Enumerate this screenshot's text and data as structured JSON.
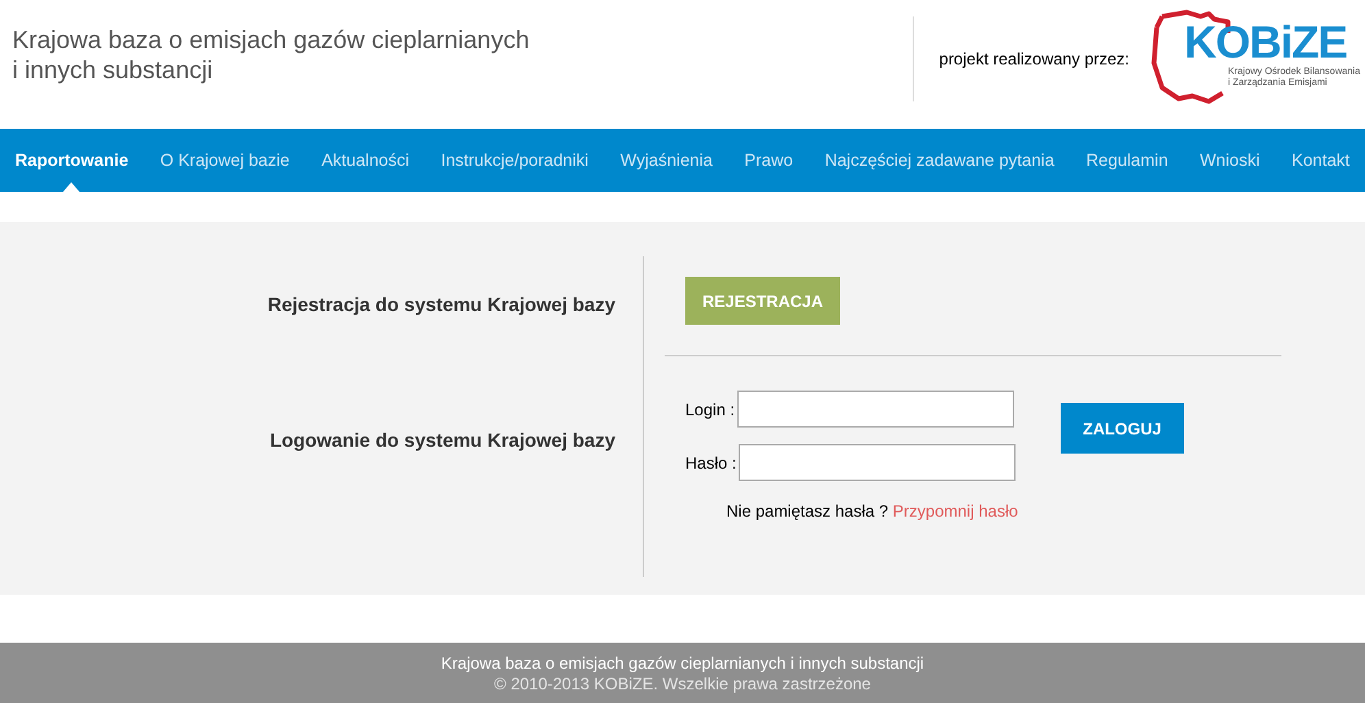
{
  "header": {
    "title_lines": [
      "Krajowa baza o emisjach gazów cieplarnianych",
      "i innych substancji"
    ],
    "partner_label": "projekt realizowany przez:",
    "logo": {
      "name": "KOBiZE",
      "subtitle_lines": [
        "Krajowy Ośrodek Bilansowania",
        "i Zarządzania Emisjami"
      ]
    }
  },
  "nav": [
    {
      "label": "Raportowanie",
      "selected": true
    },
    {
      "label": "O Krajowej bazie",
      "selected": false
    },
    {
      "label": "Aktualności",
      "selected": false
    },
    {
      "label": "Instrukcje/poradniki",
      "selected": false
    },
    {
      "label": "Wyjaśnienia",
      "selected": false
    },
    {
      "label": "Prawo",
      "selected": false
    },
    {
      "label": "Najczęściej zadawane pytania",
      "selected": false
    },
    {
      "label": "Regulamin",
      "selected": false
    },
    {
      "label": "Wnioski",
      "selected": false
    },
    {
      "label": "Kontakt",
      "selected": false
    }
  ],
  "registration": {
    "heading": "Rejestracja do systemu Krajowej bazy",
    "button": "REJESTRACJA"
  },
  "login": {
    "heading": "Logowanie do systemu Krajowej bazy",
    "login_label": "Login :",
    "password_label": "Hasło :",
    "button": "ZALOGUJ",
    "forgot_text": "Nie pamiętasz hasła ?",
    "forgot_link": "Przypomnij hasło"
  },
  "footer": {
    "line": "Krajowa baza o emisjach gazów cieplarnianych i innych substancji",
    "copyright": "© 2010-2013 KOBiZE. Wszelkie prawa zastrzeżone"
  }
}
